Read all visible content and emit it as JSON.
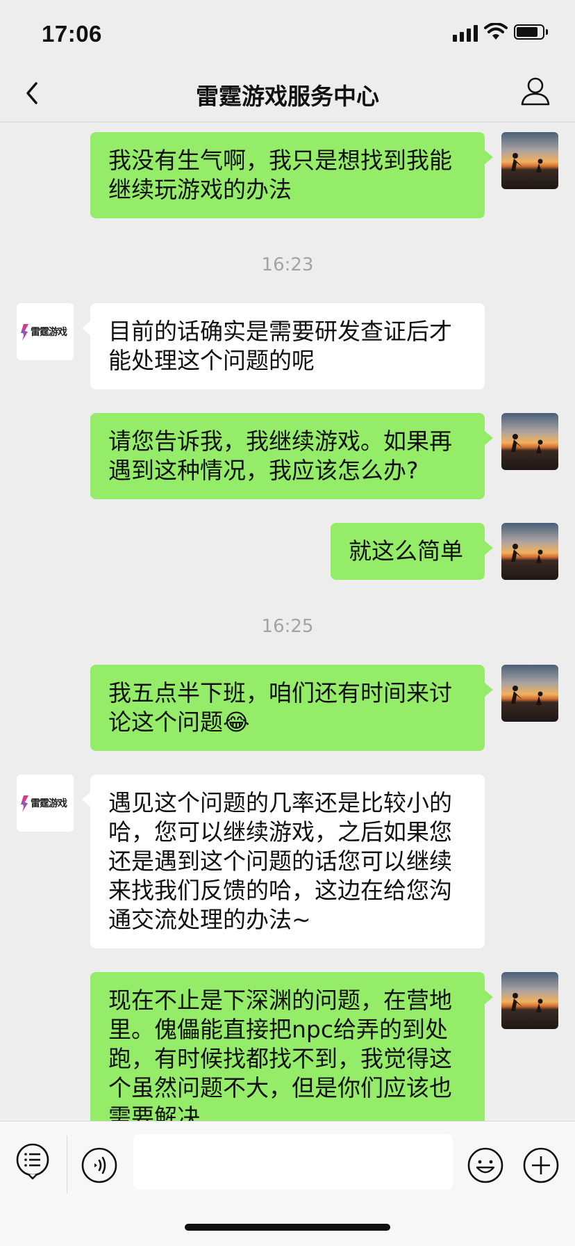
{
  "status_bar": {
    "time": "17:06"
  },
  "header": {
    "title": "雷霆游戏服务中心"
  },
  "brand": {
    "logo_text": "雷霆游戏"
  },
  "messages": [
    {
      "sender": "me",
      "text": "我没有生气啊，我只是想找到我能继续玩游戏的办法"
    },
    {
      "timestamp": "16:23"
    },
    {
      "sender": "bot",
      "text": "目前的话确实是需要研发查证后才能处理这个问题的呢"
    },
    {
      "sender": "me",
      "text": "请您告诉我，我继续游戏。如果再遇到这种情况，我应该怎么办?"
    },
    {
      "sender": "me",
      "text": "就这么简单"
    },
    {
      "timestamp": "16:25"
    },
    {
      "sender": "me",
      "text": "我五点半下班，咱们还有时间来讨论这个问题😂"
    },
    {
      "sender": "bot",
      "text": "遇见这个问题的几率还是比较小的哈，您可以继续游戏，之后如果您还是遇到这个问题的话您可以继续来找我们反馈的哈，这边在给您沟通交流处理的办法~"
    },
    {
      "sender": "me",
      "text": "现在不止是下深渊的问题，在营地里。傀儡能直接把npc给弄的到处跑，有时候找都找不到，我觉得这个虽然问题不大，但是你们应该也需要解决"
    }
  ],
  "input_bar": {
    "text": "",
    "icons": [
      "list-menu-icon",
      "voice-icon",
      "emoji-icon",
      "plus-icon"
    ]
  },
  "colors": {
    "my_bubble": "#95ec69",
    "bot_bubble": "#ffffff",
    "background": "#ededed"
  }
}
